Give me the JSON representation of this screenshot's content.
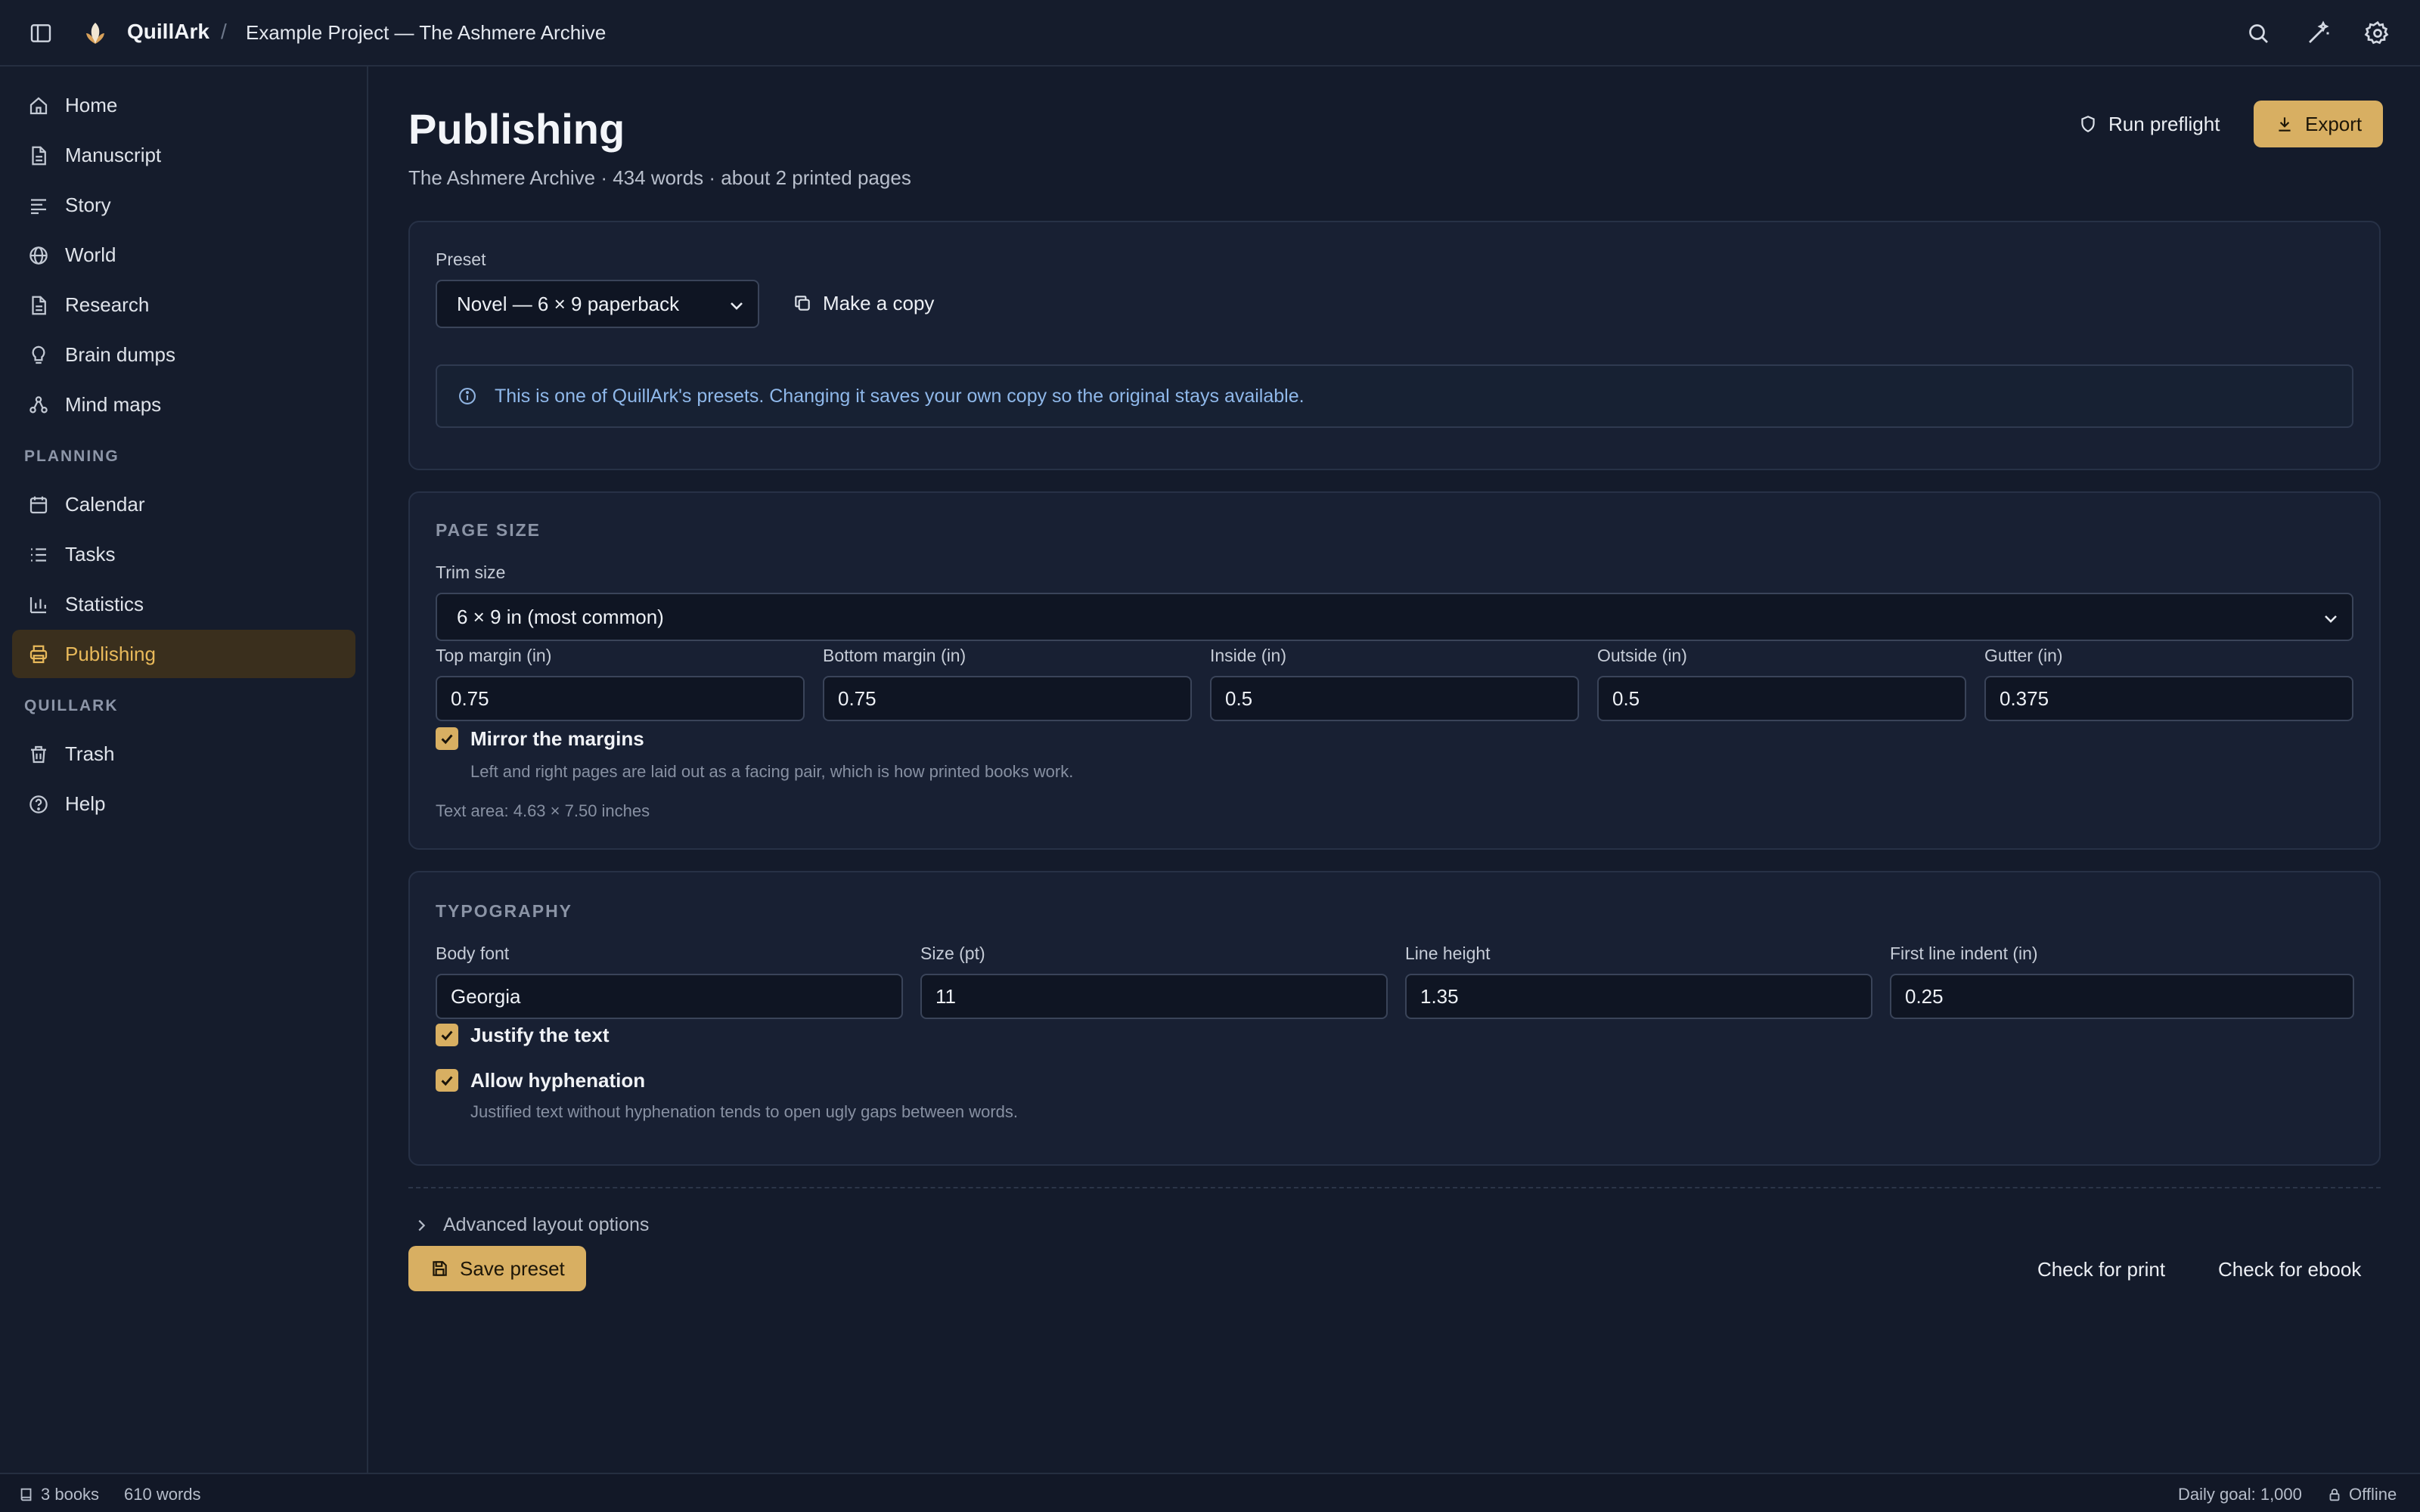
{
  "app": {
    "brand": "QuillArk",
    "project": "Example Project — The Ashmere Archive"
  },
  "sidebar": {
    "items": [
      {
        "label": "Home",
        "icon": "home-icon"
      },
      {
        "label": "Manuscript",
        "icon": "document-icon"
      },
      {
        "label": "Story",
        "icon": "story-lines-icon"
      },
      {
        "label": "World",
        "icon": "globe-icon"
      },
      {
        "label": "Research",
        "icon": "document-icon"
      },
      {
        "label": "Brain dumps",
        "icon": "lightbulb-icon"
      },
      {
        "label": "Mind maps",
        "icon": "mind-map-icon"
      }
    ],
    "planning_label": "PLANNING",
    "planning_items": [
      {
        "label": "Calendar",
        "icon": "calendar-icon"
      },
      {
        "label": "Tasks",
        "icon": "list-icon"
      },
      {
        "label": "Statistics",
        "icon": "bar-chart-icon"
      },
      {
        "label": "Publishing",
        "icon": "printer-icon",
        "active": true
      }
    ],
    "quillark_label": "QUILLARK",
    "quillark_items": [
      {
        "label": "Trash",
        "icon": "trash-icon"
      },
      {
        "label": "Help",
        "icon": "help-icon"
      }
    ]
  },
  "header": {
    "title": "Publishing",
    "subtitle": "The Ashmere Archive · 434 words · about 2 printed pages",
    "run_preflight": "Run preflight",
    "export": "Export"
  },
  "preset": {
    "label": "Preset",
    "selected": "Novel — 6 × 9 paperback",
    "make_copy": "Make a copy",
    "info": "This is one of QuillArk's presets. Changing it saves your own copy so the original stays available."
  },
  "page_size": {
    "title": "PAGE SIZE",
    "trim_label": "Trim size",
    "trim_value": "6 × 9 in (most common)",
    "top_margin_label": "Top margin (in)",
    "top_margin": "0.75",
    "bottom_margin_label": "Bottom margin (in)",
    "bottom_margin": "0.75",
    "inside_label": "Inside (in)",
    "inside": "0.5",
    "outside_label": "Outside (in)",
    "outside": "0.5",
    "gutter_label": "Gutter (in)",
    "gutter": "0.375",
    "mirror_label": "Mirror the margins",
    "mirror_checked": true,
    "mirror_hint": "Left and right pages are laid out as a facing pair, which is how printed books work.",
    "text_area": "Text area: 4.63 × 7.50 inches"
  },
  "typography": {
    "title": "TYPOGRAPHY",
    "font_label": "Body font",
    "font_value": "Georgia",
    "size_label": "Size (pt)",
    "size_value": "11",
    "line_height_label": "Line height",
    "line_height_value": "1.35",
    "indent_label": "First line indent (in)",
    "indent_value": "0.25",
    "justify_label": "Justify the text",
    "justify_checked": true,
    "hyphen_label": "Allow hyphenation",
    "hyphen_checked": true,
    "hyphen_hint": "Justified text without hyphenation tends to open ugly gaps between words."
  },
  "footer_actions": {
    "advanced": "Advanced layout options",
    "save_preset": "Save preset",
    "check_print": "Check for print",
    "check_ebook": "Check for ebook"
  },
  "status": {
    "books": "3 books",
    "words": "610 words",
    "daily_goal": "Daily goal: 1,000",
    "offline": "Offline"
  },
  "colors": {
    "accent": "#d8af62",
    "background": "#141b2b",
    "active_nav_bg": "#3a2f1d",
    "info_text": "#8fb8ea"
  }
}
